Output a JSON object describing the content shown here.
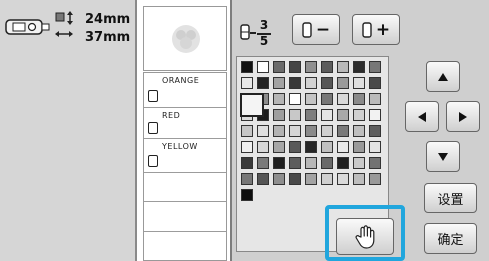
{
  "dimensions": {
    "height": "24mm",
    "width": "37mm"
  },
  "color_list": [
    {
      "name": "ORANGE"
    },
    {
      "name": "RED"
    },
    {
      "name": "YELLOW"
    }
  ],
  "thread_ratio": {
    "numerator": "3",
    "denominator": "5"
  },
  "buttons": {
    "thread_minus_symbol": "−",
    "thread_plus_symbol": "+",
    "settings_label": "设置",
    "confirm_label": "确定"
  },
  "icons": {
    "frame": "embroidery-frame-icon",
    "size": "size-arrows-icon",
    "spool": "thread-spool-icon",
    "hand": "hand-pointer-icon",
    "up": "arrow-up-icon",
    "down": "arrow-down-icon",
    "left": "arrow-left-icon",
    "right": "arrow-right-icon"
  },
  "highlight_color": "#21a6dd",
  "palette_rows": [
    [
      "#111111",
      "#ffffff",
      "#6a6a6a",
      "#454545",
      "#8f8f8f",
      "#5c5c5c",
      "#b9b9b9",
      "#2c2c2c",
      "#777777"
    ],
    [
      "#e8e8e8",
      "#222222",
      "#a3a3a3",
      "#383838",
      "#d2d2d2",
      "#565656",
      "#9a9a9a",
      "#e0e0e0",
      "#4a4a4a"
    ],
    [
      "#ffffff",
      "#8c8c8c",
      "#b5b5b5",
      "#ffffff",
      "#c4c4c4",
      "#777777",
      "#d9d9d9",
      "#8a8a8a",
      "#bababa"
    ],
    [
      "#dcdcdc",
      "#1a1a1a",
      "#9e9e9e",
      "#c8c8c8",
      "#7d7d7d",
      "#e5e5e5",
      "#a8a8a8",
      "#d0d0d0",
      "#f2f2f2"
    ],
    [
      "#c6c6c6",
      "#e0e0e0",
      "#b3b3b3",
      "#d6d6d6",
      "#8a8a8a",
      "#cfcfcf",
      "#7a7a7a",
      "#bfbfbf",
      "#5e5e5e"
    ],
    [
      "#f0f0f0",
      "#d8d8d8",
      "#a6a6a6",
      "#5a5a5a",
      "#262626",
      "#c0c0c0",
      "#e9e9e9",
      "#9a9a9a",
      "#e3e3e3"
    ],
    [
      "#3a3a3a",
      "#7a7a7a",
      "#1f1f1f",
      "#5d5d5d",
      "#b7b7b7",
      "#6a6a6a",
      "#202020",
      "#c9c9c9",
      "#727272"
    ],
    [
      "#777777",
      "#555555",
      "#8e8e8e",
      "#494949",
      "#a3a3a3",
      "#cfcfcf",
      "#dadada",
      "#bdbdbd",
      "#999999"
    ],
    [
      "#0e0e0e"
    ]
  ]
}
